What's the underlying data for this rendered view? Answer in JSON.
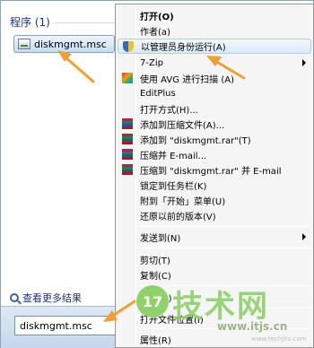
{
  "results": {
    "section_title": "程序 (1)",
    "item_label": "diskmgmt.msc",
    "see_more": "查看更多结果"
  },
  "search": {
    "value": "diskmgmt.msc"
  },
  "context_menu": {
    "items": [
      {
        "label": "打开(O)",
        "icon": null
      },
      {
        "label": "作者(a)",
        "icon": null
      },
      {
        "label": "以管理员身份运行(A)",
        "icon": "uac-shield-icon"
      },
      {
        "label": "7-Zip",
        "icon": null
      },
      {
        "label": "使用 AVG 进行扫描 (A)",
        "icon": "avg-icon"
      },
      {
        "label": "EditPlus",
        "icon": null
      },
      {
        "label": "打开方式(H)...",
        "icon": null
      },
      {
        "label": "添加到压缩文件(A)...",
        "icon": "winrar-icon"
      },
      {
        "label": "添加到 \"diskmgmt.rar\"(T)",
        "icon": "winrar-icon"
      },
      {
        "label": "压缩并 E-mail...",
        "icon": "winrar-icon"
      },
      {
        "label": "压缩到 \"diskmgmt.rar\" 并 E-mail",
        "icon": "winrar-icon"
      },
      {
        "label": "锁定到任务栏(K)",
        "icon": null
      },
      {
        "label": "附到「开始」菜单(U)",
        "icon": null
      },
      {
        "label": "还原以前的版本(V)",
        "icon": null
      },
      {
        "label": "发送到(N)",
        "icon": null
      },
      {
        "label": "剪切(T)",
        "icon": null
      },
      {
        "label": "复制(C)",
        "icon": null
      },
      {
        "label": "删除(D)",
        "icon": null
      },
      {
        "label": "打开文件位置(I)",
        "icon": null
      },
      {
        "label": "属性(R)",
        "icon": null
      }
    ]
  },
  "watermark": {
    "badge": "17",
    "brand": "技术网",
    "url": "www.itjs.cn",
    "url_small": "www.techjits.com"
  },
  "colors": {
    "accent": "#1e3287",
    "highlight": "#dbe9fb",
    "arrow": "#f0a030",
    "watermark": "#8fd16a"
  }
}
